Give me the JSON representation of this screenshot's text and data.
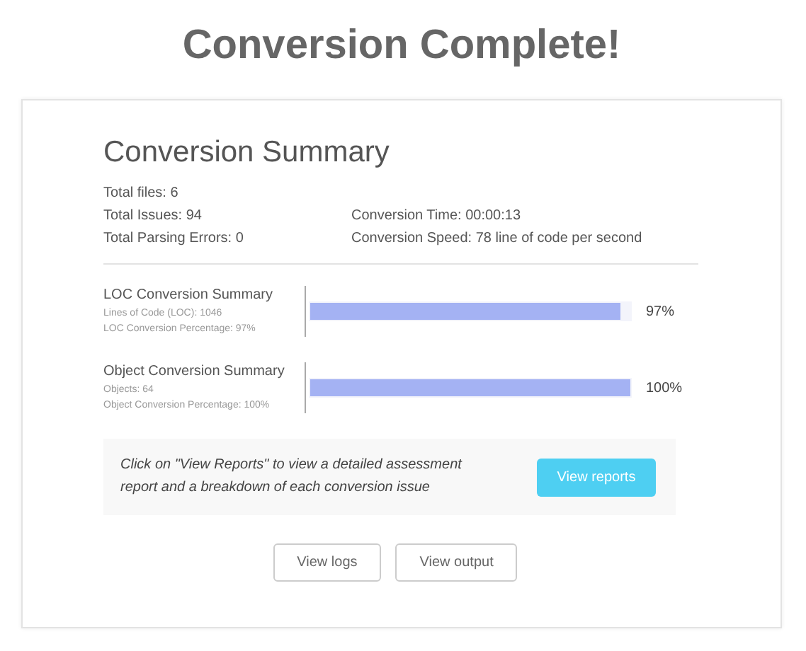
{
  "title": "Conversion Complete!",
  "summary": {
    "heading": "Conversion Summary",
    "stats_left": [
      "Total files: 6",
      "Total Issues: 94",
      "Total Parsing Errors: 0"
    ],
    "stats_right": [
      "Conversion Time: 00:00:13",
      "Conversion Speed: 78 line of code per second"
    ]
  },
  "sections": [
    {
      "name": "LOC Conversion Summary",
      "details": [
        "Lines of Code (LOC): 1046",
        "LOC Conversion Percentage: 97%"
      ],
      "level": 0.97,
      "reading": "97%"
    },
    {
      "name": "Object Conversion Summary",
      "details": [
        "Objects: 64",
        "Object Conversion Percentage: 100%"
      ],
      "level": 1.0,
      "reading": "100%"
    }
  ],
  "info": {
    "text": "Click on \"View Reports\" to view a detailed assessment report and a breakdown of each conversion issue",
    "button": "View reports"
  },
  "buttons": [
    "View logs",
    "View output"
  ]
}
